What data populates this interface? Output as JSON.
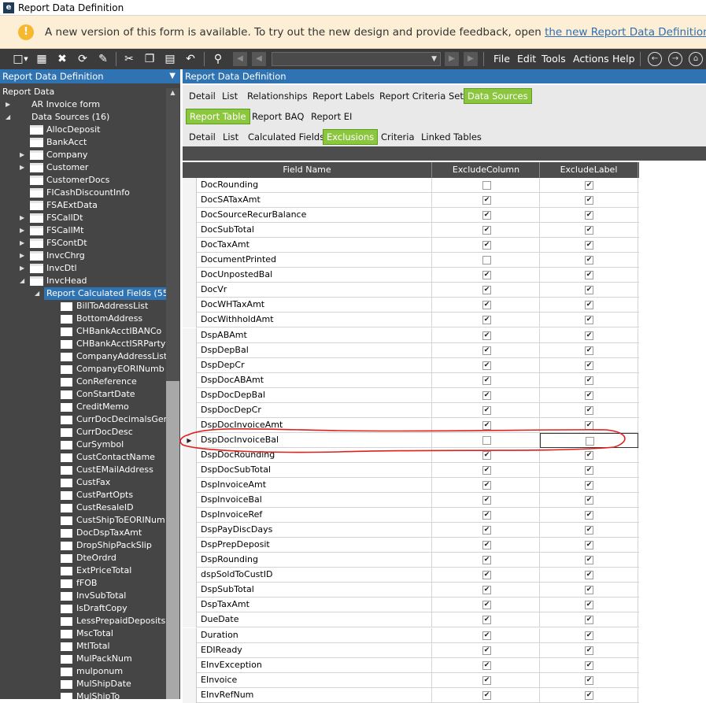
{
  "window": {
    "title": "Report Data Definition",
    "logo_letter": "e"
  },
  "banner": {
    "text": "A new version of this form is available. To try out the new design and provide feedback, open ",
    "link": "the new Report Data Definition app",
    "suffix": ".",
    "icon": "info-icon"
  },
  "toolbar": {
    "menus": [
      "File",
      "Edit",
      "Tools",
      "Actions",
      "Help"
    ],
    "icons": [
      "new-icon",
      "save-icon",
      "delete-icon",
      "refresh-icon",
      "clear-icon",
      "cut-icon",
      "copy-icon",
      "paste-icon",
      "undo-icon",
      "search-icon"
    ]
  },
  "left_panel": {
    "header": "Report Data Definition",
    "tree": [
      {
        "label": "Report Data",
        "level": 0,
        "expander": "",
        "icon": ""
      },
      {
        "label": "AR Invoice form",
        "level": 1,
        "expander": "right",
        "icon": ""
      },
      {
        "label": "Data Sources (16)",
        "level": 1,
        "expander": "down",
        "icon": ""
      },
      {
        "label": "AllocDeposit",
        "level": 2,
        "expander": "",
        "icon": "folder"
      },
      {
        "label": "BankAcct",
        "level": 2,
        "expander": "",
        "icon": "folder"
      },
      {
        "label": "Company",
        "level": 2,
        "expander": "right",
        "icon": "folder"
      },
      {
        "label": "Customer",
        "level": 2,
        "expander": "right",
        "icon": "folder"
      },
      {
        "label": "CustomerDocs",
        "level": 2,
        "expander": "",
        "icon": "folder"
      },
      {
        "label": "FICashDiscountInfo",
        "level": 2,
        "expander": "",
        "icon": "folder"
      },
      {
        "label": "FSAExtData",
        "level": 2,
        "expander": "",
        "icon": "folder"
      },
      {
        "label": "FSCallDt",
        "level": 2,
        "expander": "right",
        "icon": "folder"
      },
      {
        "label": "FSCallMt",
        "level": 2,
        "expander": "right",
        "icon": "folder"
      },
      {
        "label": "FSContDt",
        "level": 2,
        "expander": "right",
        "icon": "folder"
      },
      {
        "label": "InvcChrg",
        "level": 2,
        "expander": "right",
        "icon": "folder"
      },
      {
        "label": "InvcDtl",
        "level": 2,
        "expander": "right",
        "icon": "folder"
      },
      {
        "label": "InvcHead",
        "level": 2,
        "expander": "down",
        "icon": "folder"
      },
      {
        "label": "Report Calculated Fields (55)",
        "level": 3,
        "expander": "down",
        "icon": "",
        "selected": true
      },
      {
        "label": "BillToAddressList",
        "level": 4,
        "icon": "field"
      },
      {
        "label": "BottomAddress",
        "level": 4,
        "icon": "field"
      },
      {
        "label": "CHBankAcctIBANCo",
        "level": 4,
        "icon": "field"
      },
      {
        "label": "CHBankAcctISRParty",
        "level": 4,
        "icon": "field"
      },
      {
        "label": "CompanyAddressList",
        "level": 4,
        "icon": "field"
      },
      {
        "label": "CompanyEORINumb",
        "level": 4,
        "icon": "field"
      },
      {
        "label": "ConReference",
        "level": 4,
        "icon": "field"
      },
      {
        "label": "ConStartDate",
        "level": 4,
        "icon": "field"
      },
      {
        "label": "CreditMemo",
        "level": 4,
        "icon": "field"
      },
      {
        "label": "CurrDocDecimalsGen",
        "level": 4,
        "icon": "field"
      },
      {
        "label": "CurrDocDesc",
        "level": 4,
        "icon": "field"
      },
      {
        "label": "CurSymbol",
        "level": 4,
        "icon": "field"
      },
      {
        "label": "CustContactName",
        "level": 4,
        "icon": "field"
      },
      {
        "label": "CustEMailAddress",
        "level": 4,
        "icon": "field"
      },
      {
        "label": "CustFax",
        "level": 4,
        "icon": "field"
      },
      {
        "label": "CustPartOpts",
        "level": 4,
        "icon": "field"
      },
      {
        "label": "CustResaleID",
        "level": 4,
        "icon": "field"
      },
      {
        "label": "CustShipToEORINum",
        "level": 4,
        "icon": "field"
      },
      {
        "label": "DocDspTaxAmt",
        "level": 4,
        "icon": "field"
      },
      {
        "label": "DropShipPackSlip",
        "level": 4,
        "icon": "field"
      },
      {
        "label": "DteOrdrd",
        "level": 4,
        "icon": "field"
      },
      {
        "label": "ExtPriceTotal",
        "level": 4,
        "icon": "field"
      },
      {
        "label": "fFOB",
        "level": 4,
        "icon": "field"
      },
      {
        "label": "InvSubTotal",
        "level": 4,
        "icon": "field"
      },
      {
        "label": "IsDraftCopy",
        "level": 4,
        "icon": "field"
      },
      {
        "label": "LessPrepaidDeposits",
        "level": 4,
        "icon": "field"
      },
      {
        "label": "MscTotal",
        "level": 4,
        "icon": "field"
      },
      {
        "label": "MtlTotal",
        "level": 4,
        "icon": "field"
      },
      {
        "label": "MulPackNum",
        "level": 4,
        "icon": "field"
      },
      {
        "label": "mulponum",
        "level": 4,
        "icon": "field"
      },
      {
        "label": "MulShipDate",
        "level": 4,
        "icon": "field"
      },
      {
        "label": "MulShipTo",
        "level": 4,
        "icon": "field"
      }
    ]
  },
  "right_panel": {
    "header": "Report Data Definition",
    "tabs_top": [
      {
        "label": "Detail",
        "active": false
      },
      {
        "label": "List",
        "active": false
      },
      {
        "label": "Relationships",
        "active": false
      },
      {
        "label": "Report Labels",
        "active": false
      },
      {
        "label": "Report Criteria Sets",
        "active": false
      },
      {
        "label": "Data Sources",
        "active": true
      }
    ],
    "tabs_mid": [
      {
        "label": "Report Table",
        "active": true
      },
      {
        "label": "Report BAQ",
        "active": false
      },
      {
        "label": "Report EI",
        "active": false
      }
    ],
    "tabs_sub": [
      {
        "label": "Detail",
        "active": false
      },
      {
        "label": "List",
        "active": false
      },
      {
        "label": "Calculated Fields",
        "active": false
      },
      {
        "label": "Exclusions",
        "active": true
      },
      {
        "label": "Criteria",
        "active": false
      },
      {
        "label": "Linked Tables",
        "active": false
      }
    ],
    "grid": {
      "columns": [
        "Field Name",
        "ExcludeColumn",
        "ExcludeLabel"
      ],
      "rows": [
        {
          "field": "DocRounding",
          "col": false,
          "lab": true
        },
        {
          "field": "DocSATaxAmt",
          "col": true,
          "lab": true
        },
        {
          "field": "DocSourceRecurBalance",
          "col": true,
          "lab": true
        },
        {
          "field": "DocSubTotal",
          "col": true,
          "lab": true
        },
        {
          "field": "DocTaxAmt",
          "col": true,
          "lab": true
        },
        {
          "field": "DocumentPrinted",
          "col": false,
          "lab": true
        },
        {
          "field": "DocUnpostedBal",
          "col": true,
          "lab": true
        },
        {
          "field": "DocVr",
          "col": true,
          "lab": true
        },
        {
          "field": "DocWHTaxAmt",
          "col": true,
          "lab": true
        },
        {
          "field": "DocWithholdAmt",
          "col": true,
          "lab": true
        },
        {
          "field": "DspABAmt",
          "col": true,
          "lab": true
        },
        {
          "field": "DspDepBal",
          "col": true,
          "lab": true
        },
        {
          "field": "DspDepCr",
          "col": true,
          "lab": true
        },
        {
          "field": "DspDocABAmt",
          "col": true,
          "lab": true
        },
        {
          "field": "DspDocDepBal",
          "col": true,
          "lab": true
        },
        {
          "field": "DspDocDepCr",
          "col": true,
          "lab": true
        },
        {
          "field": "DspDocInvoiceAmt",
          "col": true,
          "lab": true
        },
        {
          "field": "DspDocInvoiceBal",
          "col": false,
          "lab": false,
          "current": true
        },
        {
          "field": "DspDocRounding",
          "col": true,
          "lab": true
        },
        {
          "field": "DspDocSubTotal",
          "col": true,
          "lab": true
        },
        {
          "field": "DspInvoiceAmt",
          "col": true,
          "lab": true
        },
        {
          "field": "DspInvoiceBal",
          "col": true,
          "lab": true
        },
        {
          "field": "DspInvoiceRef",
          "col": true,
          "lab": true
        },
        {
          "field": "DspPayDiscDays",
          "col": true,
          "lab": true
        },
        {
          "field": "DspPrepDeposit",
          "col": true,
          "lab": true
        },
        {
          "field": "DspRounding",
          "col": true,
          "lab": true
        },
        {
          "field": "dspSoldToCustID",
          "col": true,
          "lab": true
        },
        {
          "field": "DspSubTotal",
          "col": true,
          "lab": true
        },
        {
          "field": "DspTaxAmt",
          "col": true,
          "lab": true
        },
        {
          "field": "DueDate",
          "col": true,
          "lab": true
        },
        {
          "field": "Duration",
          "col": true,
          "lab": true
        },
        {
          "field": "EDIReady",
          "col": true,
          "lab": true
        },
        {
          "field": "EInvException",
          "col": true,
          "lab": true
        },
        {
          "field": "EInvoice",
          "col": true,
          "lab": true
        },
        {
          "field": "EInvRefNum",
          "col": true,
          "lab": true
        }
      ]
    }
  },
  "colors": {
    "accent_blue": "#2f73b3",
    "tab_green": "#8cc63f",
    "annotation_red": "#e0201e",
    "banner_bg": "#fdefd6"
  }
}
